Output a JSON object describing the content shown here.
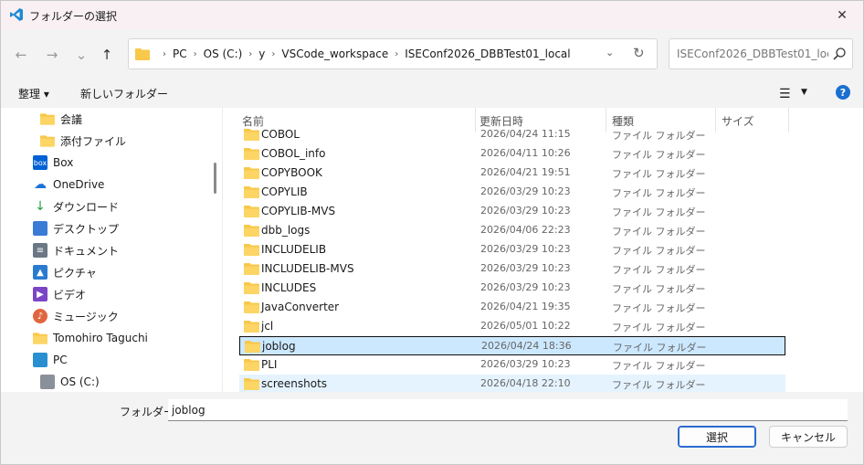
{
  "window": {
    "title": "フォルダーの選択",
    "close_glyph": "✕"
  },
  "nav": {
    "back_glyph": "←",
    "forward_glyph": "→",
    "recent_glyph": "⌄",
    "up_glyph": "↑",
    "breadcrumbs": [
      "PC",
      "OS (C:)",
      "y",
      "VSCode_workspace",
      "ISEConf2026_DBBTest01_local"
    ],
    "sep_glyph": "›",
    "refresh_glyph": "↻",
    "dropdown_glyph": "⌄",
    "search_placeholder": "ISEConf2026_DBBTest01_local..."
  },
  "toolbar": {
    "organize_label": "整理 ▾",
    "new_folder_label": "新しいフォルダー",
    "view_glyph": "☰",
    "view_chevron": "▼",
    "help_glyph": "?"
  },
  "navpane": {
    "items": [
      {
        "label": "会議",
        "icon": "folder-icon"
      },
      {
        "label": "添付ファイル",
        "icon": "folder-icon"
      },
      {
        "label": "Box",
        "icon": "box-icon",
        "icon_text": "box"
      },
      {
        "label": "OneDrive",
        "icon": "cloud-icon"
      },
      {
        "label": "ダウンロード",
        "icon": "download-icon"
      },
      {
        "label": "デスクトップ",
        "icon": "desktop-icon"
      },
      {
        "label": "ドキュメント",
        "icon": "document-icon"
      },
      {
        "label": "ピクチャ",
        "icon": "pictures-icon"
      },
      {
        "label": "ビデオ",
        "icon": "video-icon"
      },
      {
        "label": "ミュージック",
        "icon": "music-icon"
      },
      {
        "label": "Tomohiro Taguchi",
        "icon": "folder-icon"
      },
      {
        "label": "PC",
        "icon": "pc-icon"
      },
      {
        "label": "OS (C:)",
        "icon": "drive-icon"
      }
    ]
  },
  "files": {
    "columns": {
      "name": "名前",
      "modified": "更新日時",
      "type": "種類",
      "size": "サイズ"
    },
    "sort_glyph": "^",
    "rows": [
      {
        "name": "COBOL",
        "modified": "2026/04/24 11:15",
        "type": "ファイル フォルダー"
      },
      {
        "name": "COBOL_info",
        "modified": "2026/04/11 10:26",
        "type": "ファイル フォルダー"
      },
      {
        "name": "COPYBOOK",
        "modified": "2026/04/21 19:51",
        "type": "ファイル フォルダー"
      },
      {
        "name": "COPYLIB",
        "modified": "2026/03/29 10:23",
        "type": "ファイル フォルダー"
      },
      {
        "name": "COPYLIB-MVS",
        "modified": "2026/03/29 10:23",
        "type": "ファイル フォルダー"
      },
      {
        "name": "dbb_logs",
        "modified": "2026/04/06 22:23",
        "type": "ファイル フォルダー"
      },
      {
        "name": "INCLUDELIB",
        "modified": "2026/03/29 10:23",
        "type": "ファイル フォルダー"
      },
      {
        "name": "INCLUDELIB-MVS",
        "modified": "2026/03/29 10:23",
        "type": "ファイル フォルダー"
      },
      {
        "name": "INCLUDES",
        "modified": "2026/03/29 10:23",
        "type": "ファイル フォルダー"
      },
      {
        "name": "JavaConverter",
        "modified": "2026/04/21 19:35",
        "type": "ファイル フォルダー"
      },
      {
        "name": "jcl",
        "modified": "2026/05/01 10:22",
        "type": "ファイル フォルダー"
      },
      {
        "name": "joblog",
        "modified": "2026/04/24 18:36",
        "type": "ファイル フォルダー"
      },
      {
        "name": "PLI",
        "modified": "2026/03/29 10:23",
        "type": "ファイル フォルダー"
      },
      {
        "name": "screenshots",
        "modified": "2026/04/18 22:10",
        "type": "ファイル フォルダー"
      }
    ]
  },
  "bottom": {
    "folder_label": "フォルダー:",
    "folder_value": "joblog",
    "select_label": "選択",
    "cancel_label": "キャンセル"
  },
  "colors": {
    "accent": "#0078d4",
    "folder": "#f8c84a",
    "selection": "#cce8ff",
    "hover": "#e5f3ff"
  }
}
